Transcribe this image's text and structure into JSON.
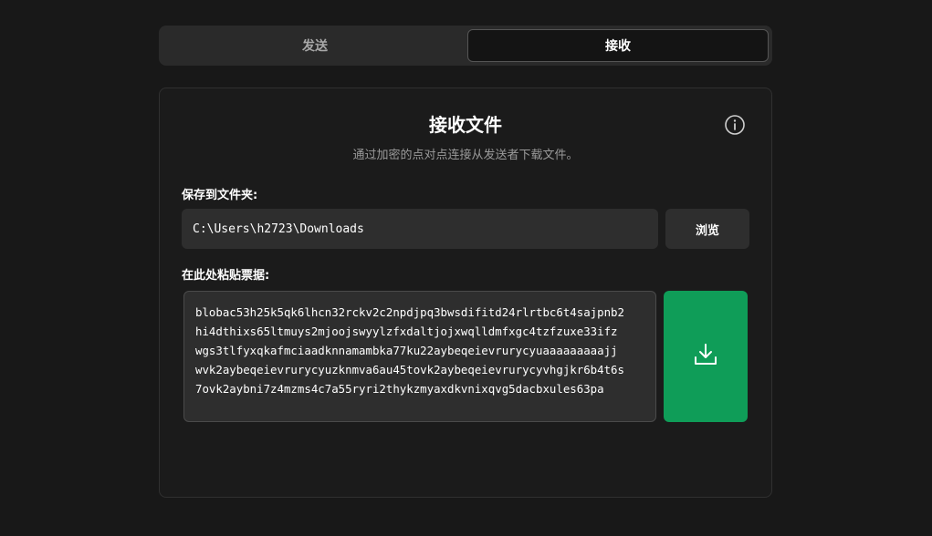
{
  "tabs": {
    "send_label": "发送",
    "receive_label": "接收",
    "active": "receive"
  },
  "card": {
    "title": "接收文件",
    "subtitle": "通过加密的点对点连接从发送者下载文件。",
    "info_icon": "info-circle-icon"
  },
  "folder": {
    "label": "保存到文件夹:",
    "path_value": "C:\\Users\\h2723\\Downloads",
    "browse_label": "浏览"
  },
  "ticket": {
    "label": "在此处粘贴票据:",
    "value": "blobac53h25k5qk6lhcn32rckv2c2npdjpq3bwsdifitd24rlrtbc6t4sajpnb2\nhi4dthixs65ltmuys2mjoojswyylzfxdaltjojxwqlldmfxgc4tzfzuxe33ifz\nwgs3tlfyxqkafmciaadknnamambka77ku22aybeqeievrurycyuaaaaaaaaajj\nwvk2aybeqeievrurycyuzknmva6au45tovk2aybeqeievrurycyvhgjkr6b4t6s\n7ovk2aybni7z4mzms4c7a55ryri2thykzmyaxdkvnixqvg5dacbxules63pa",
    "download_icon": "download-icon"
  },
  "colors": {
    "background": "#181818",
    "accent_green": "#0f9d58"
  }
}
